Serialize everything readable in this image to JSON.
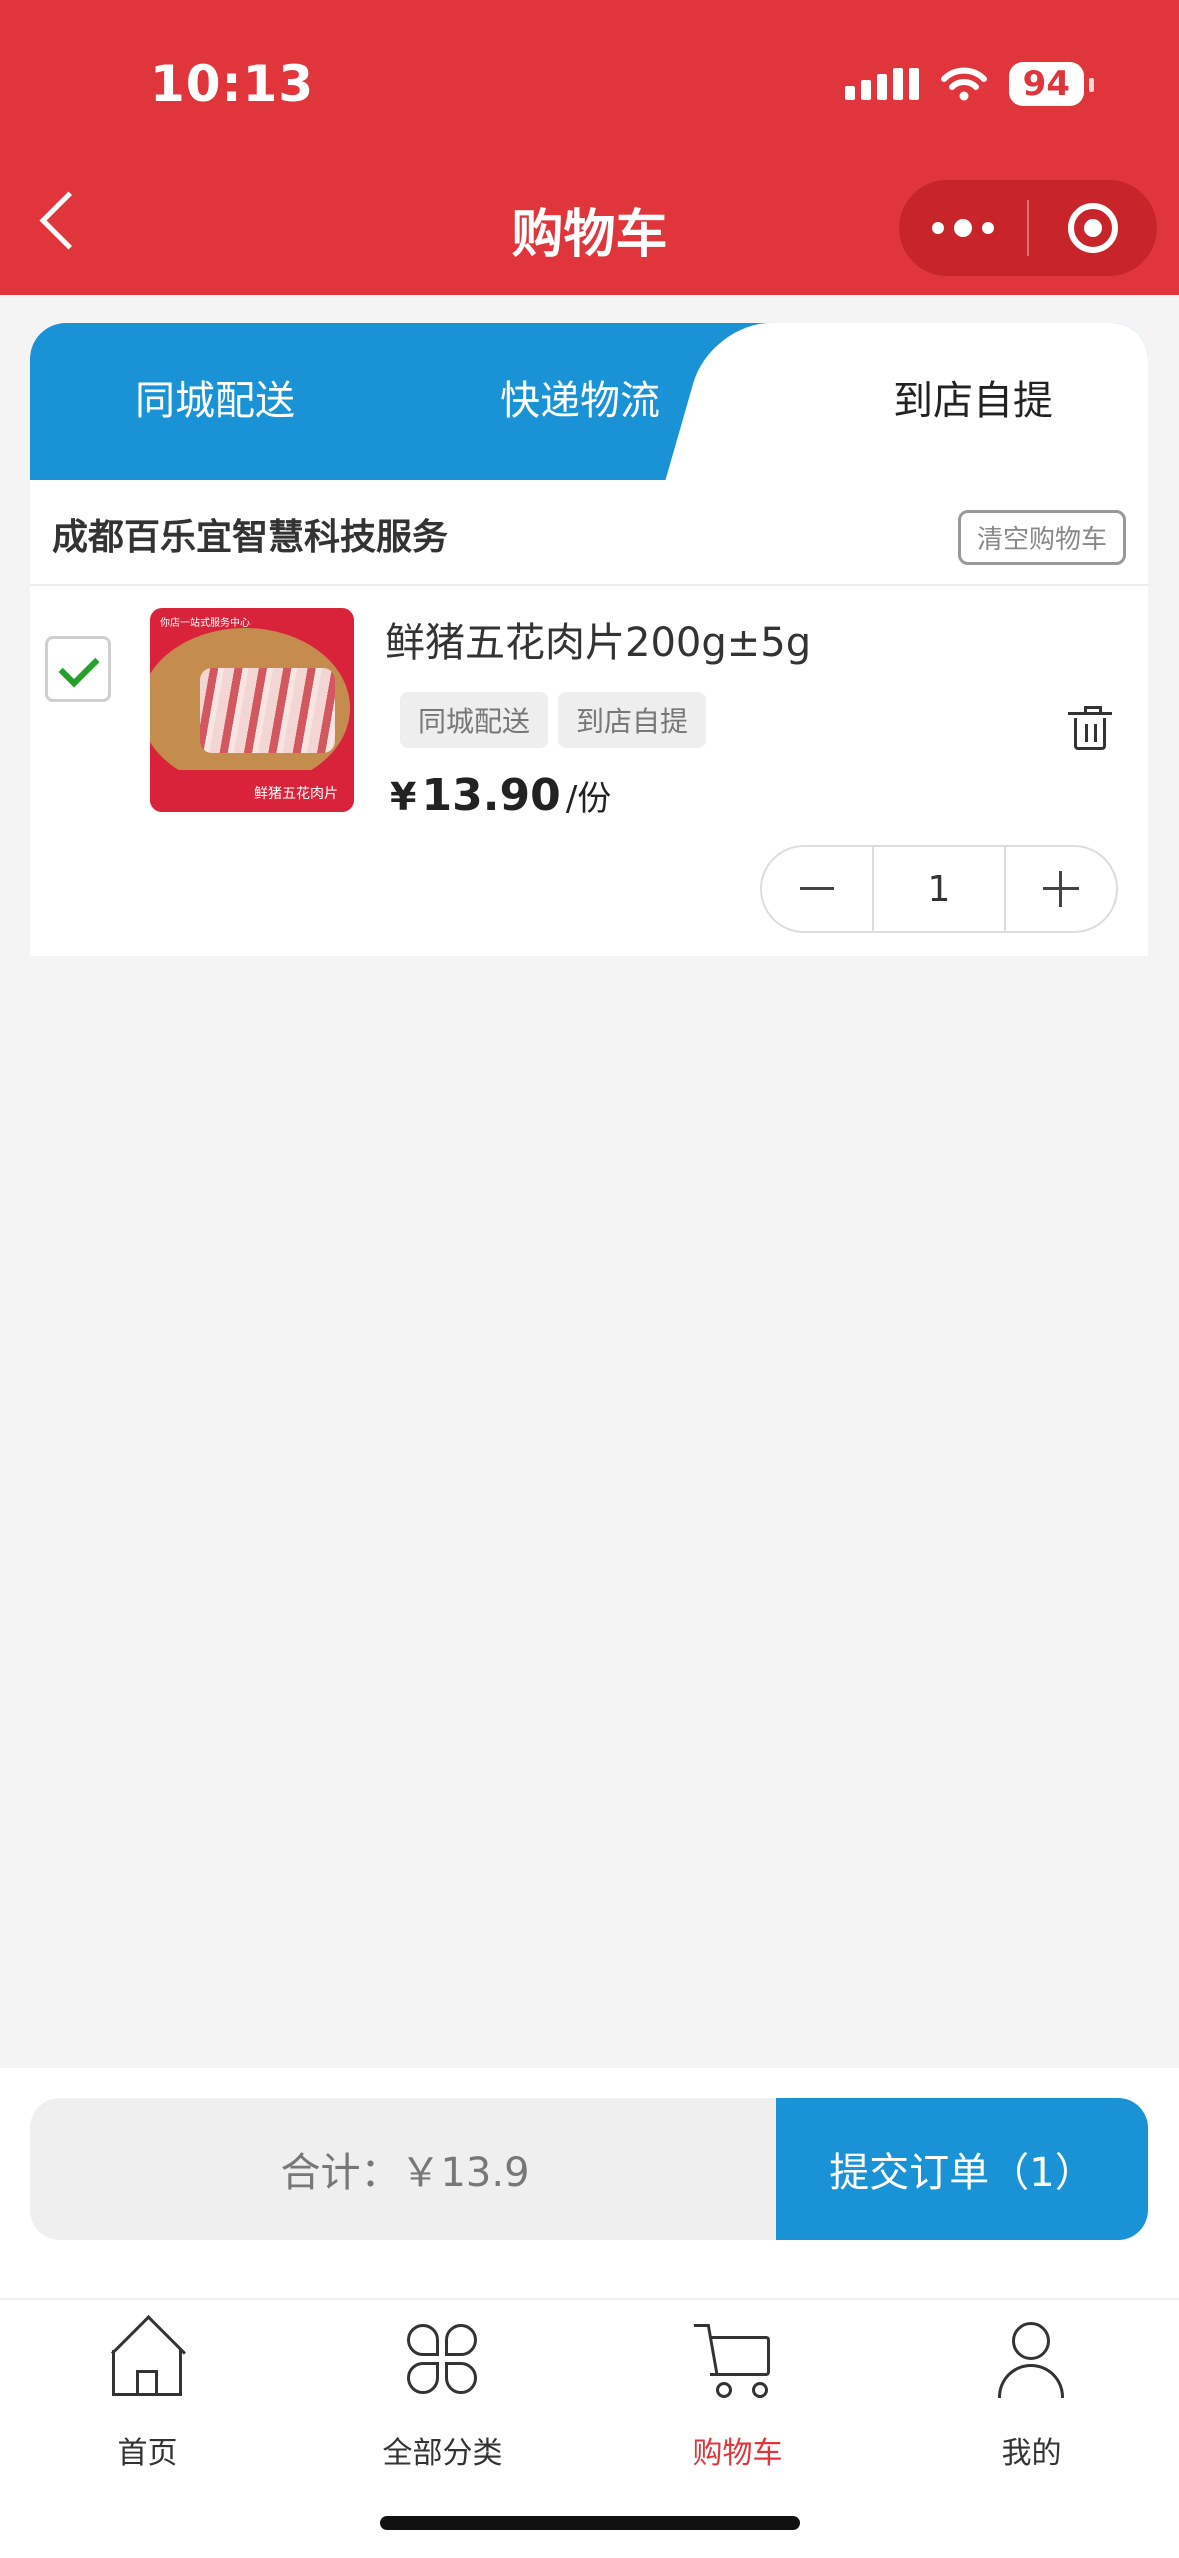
{
  "status_bar": {
    "time": "10:13",
    "battery": "94"
  },
  "nav": {
    "title": "购物车"
  },
  "tabs": [
    {
      "label": "同城配送"
    },
    {
      "label": "快递物流"
    },
    {
      "label": "到店自提"
    }
  ],
  "store": {
    "name": "成都百乐宜智慧科技服务",
    "clear_label": "清空购物车"
  },
  "item": {
    "name": "鲜猪五花肉片200g±5g",
    "tags": [
      "同城配送",
      "到店自提"
    ],
    "currency": "¥",
    "price": "13.90",
    "unit": "/份",
    "quantity": "1",
    "checked": true,
    "image_text": {
      "top": "你店一站式服务中心",
      "label": "鲜猪五花肉片"
    }
  },
  "footer": {
    "total_label": "合计：",
    "total_value": "￥13.9",
    "submit_label": "提交订单（1）"
  },
  "tabbar": [
    {
      "label": "首页",
      "icon": "home-icon"
    },
    {
      "label": "全部分类",
      "icon": "grid-icon"
    },
    {
      "label": "购物车",
      "icon": "cart-icon",
      "active": true
    },
    {
      "label": "我的",
      "icon": "user-icon"
    }
  ],
  "colors": {
    "header": "#e0363b",
    "accent_blue": "#1a93d6",
    "active_tab_text": "#e0363b"
  }
}
